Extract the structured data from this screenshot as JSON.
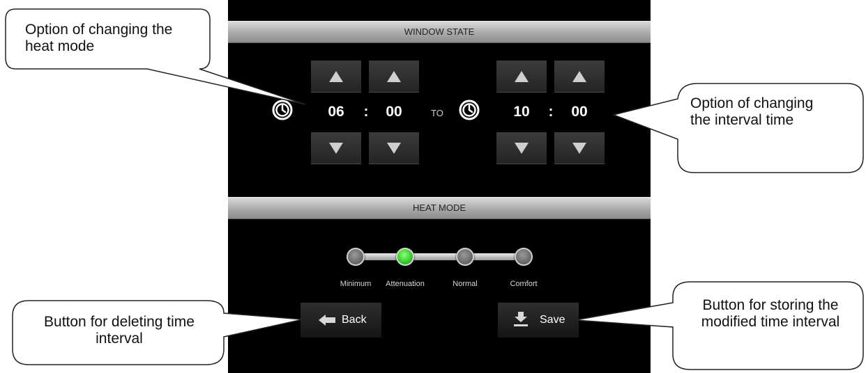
{
  "screen": {
    "window_state_title": "WINDOW STATE",
    "heat_mode_title": "HEAT MODE",
    "interval": {
      "from_hour": "06",
      "from_minute": "00",
      "separator": ":",
      "to_label": "TO",
      "to_hour": "10",
      "to_minute": "00"
    },
    "heat_modes": [
      "Minimum",
      "Attenuation",
      "Normal",
      "Comfort"
    ],
    "selected_mode": "Attenuation",
    "back_label": "Back",
    "save_label": "Save"
  },
  "callouts": {
    "heat_mode": "Option of changing the heat mode",
    "interval_time": "Option of changing the interval time",
    "delete_interval": "Button for deleting time interval",
    "store_interval": "Button for storing the modified time interval"
  },
  "colors": {
    "active_mode": "#22c11a",
    "screen_bg": "#000000",
    "section_bar": "#a9a9a9"
  },
  "icons": [
    "clock-icon",
    "up-arrow-icon",
    "down-arrow-icon",
    "back-arrow-icon",
    "save-icon"
  ]
}
